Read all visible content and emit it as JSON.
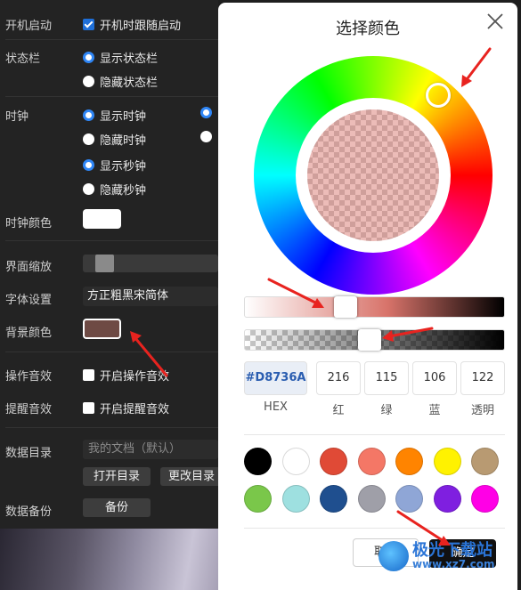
{
  "settings": {
    "startup": {
      "label": "开机启动",
      "option": "开机时跟随启动",
      "checked": true
    },
    "statusbar": {
      "label": "状态栏",
      "options": [
        "显示状态栏",
        "隐藏状态栏"
      ],
      "selected": 0
    },
    "clock": {
      "label": "时钟",
      "options": [
        "显示时钟",
        "隐藏时钟",
        "显示秒钟",
        "隐藏秒钟"
      ]
    },
    "clock_color": {
      "label": "时钟颜色",
      "value": "#ffffff"
    },
    "zoom": {
      "label": "界面缩放"
    },
    "font": {
      "label": "字体设置",
      "value": "方正粗黑宋简体"
    },
    "bg_color": {
      "label": "背景颜色",
      "value": "#6e4a44"
    },
    "op_sound": {
      "label": "操作音效",
      "option": "开启操作音效",
      "checked": false
    },
    "remind_sound": {
      "label": "提醒音效",
      "option": "开启提醒音效",
      "checked": false
    },
    "data_dir": {
      "label": "数据目录",
      "placeholder": "我的文档（默认）",
      "open_btn": "打开目录",
      "change_btn": "更改目录"
    },
    "backup": {
      "label": "数据备份",
      "btn": "备份"
    }
  },
  "dialog": {
    "title": "选择颜色",
    "hex": "#D8736A",
    "r": "216",
    "g": "115",
    "b": "106",
    "a": "122",
    "labels": {
      "hex": "HEX",
      "r": "红",
      "g": "绿",
      "b": "蓝",
      "a": "透明"
    },
    "presets_row1": [
      "#000000",
      "#ffffff",
      "#e04a36",
      "#f47766",
      "#ff8400",
      "#fff200",
      "#b89a72"
    ],
    "presets_row2": [
      "#7ac74a",
      "#9ee0e0",
      "#1f4f8f",
      "#9f9fa8",
      "#8fa6d6",
      "#7f1fe0",
      "#ff00e6"
    ],
    "cancel": "取消",
    "ok": "确定",
    "hue_position": 0.38,
    "alpha_position": 0.48
  },
  "watermark": {
    "name": "极光下载站",
    "url": "www.xz7.com"
  }
}
